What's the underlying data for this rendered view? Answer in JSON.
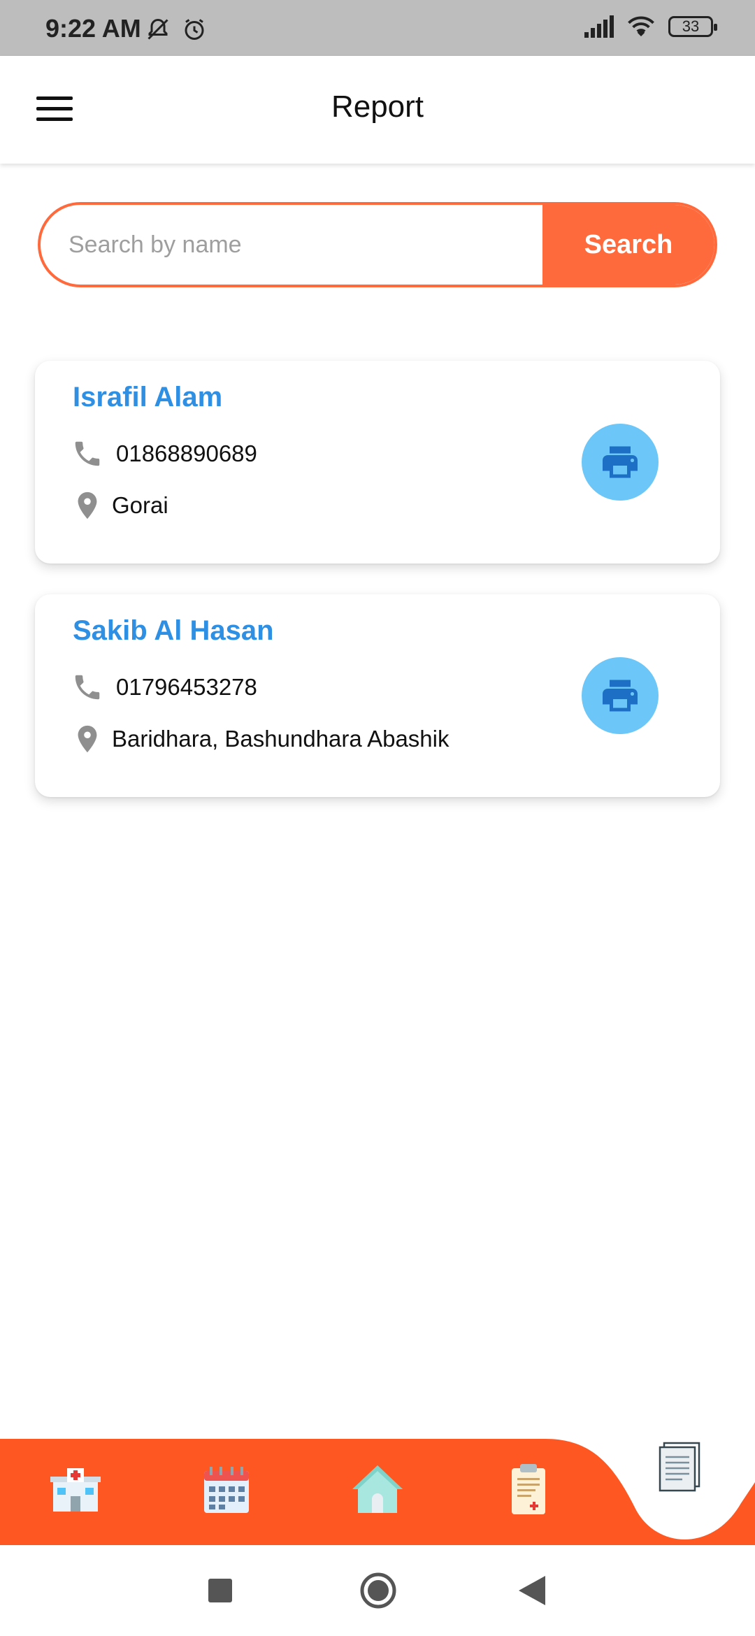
{
  "status_bar": {
    "time": "9:22 AM",
    "battery": "33"
  },
  "app_bar": {
    "title": "Report"
  },
  "search": {
    "placeholder": "Search by name",
    "button_label": "Search"
  },
  "records": [
    {
      "name": "Israfil Alam",
      "phone": "01868890689",
      "location": "Gorai"
    },
    {
      "name": "Sakib Al Hasan",
      "phone": "01796453278",
      "location": "Baridhara, Bashundhara Abashik"
    }
  ],
  "bottom_nav": {
    "items": [
      "hospital-icon",
      "calendar-icon",
      "home-icon",
      "clipboard-icon",
      "document-icon"
    ],
    "active": "document-icon"
  },
  "colors": {
    "accent": "#ff6a3d",
    "nav_bar": "#ff5722",
    "name_blue": "#2f8fe3",
    "print_button": "#6cc6f7",
    "status_bar": "#bdbdbd"
  }
}
